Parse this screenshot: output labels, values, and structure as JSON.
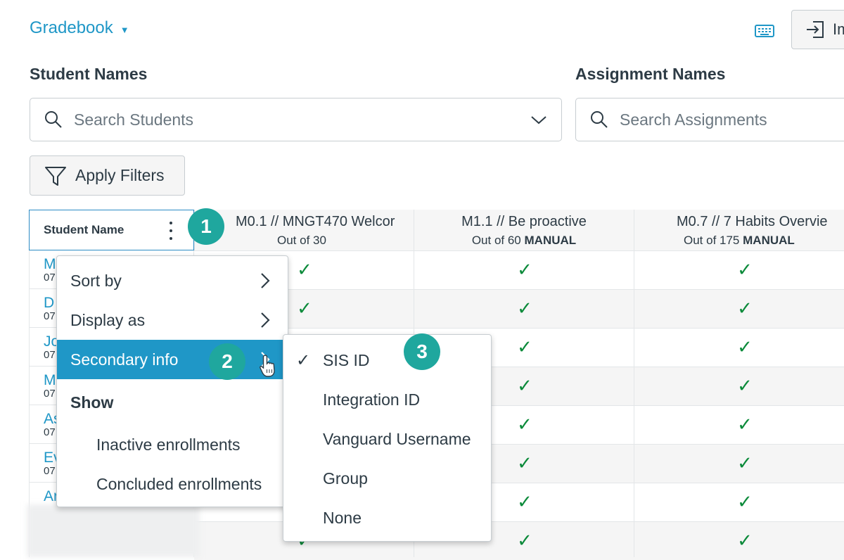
{
  "header": {
    "gradebook_label": "Gradebook",
    "import_label": "Im"
  },
  "filters": {
    "student_names_label": "Student Names",
    "student_search_placeholder": "Search Students",
    "assignment_names_label": "Assignment Names",
    "assignment_search_placeholder": "Search Assignments",
    "apply_filters_label": "Apply Filters"
  },
  "grid": {
    "student_column_header": "Student Name",
    "assignments": [
      {
        "title": "M0.1 // MNGT470 Welcor",
        "out_of": "Out of 30",
        "type_label": ""
      },
      {
        "title": "M1.1 // Be proactive",
        "out_of": "Out of 60",
        "type_label": "MANUAL"
      },
      {
        "title": "M0.7 // 7 Habits Overvie",
        "out_of": "Out of 175",
        "type_label": "MANUAL"
      }
    ],
    "students": [
      {
        "name": "M",
        "secondary": "07"
      },
      {
        "name": "D",
        "secondary": "07"
      },
      {
        "name": "Jo",
        "secondary": "07"
      },
      {
        "name": "M",
        "secondary": "07"
      },
      {
        "name": "As",
        "secondary": "07"
      },
      {
        "name": "Ev",
        "secondary": "07"
      },
      {
        "name": "Ar",
        "secondary": ""
      }
    ],
    "check_glyph": "✓"
  },
  "column_menu": {
    "items": [
      {
        "label": "Sort by"
      },
      {
        "label": "Display as"
      },
      {
        "label": "Secondary info"
      }
    ],
    "show_heading": "Show",
    "show_items": [
      {
        "label": "Inactive enrollments"
      },
      {
        "label": "Concluded enrollments"
      }
    ]
  },
  "secondary_info_menu": {
    "items": [
      {
        "label": "SIS ID",
        "selected": true
      },
      {
        "label": "Integration ID",
        "selected": false
      },
      {
        "label": "Vanguard Username",
        "selected": false
      },
      {
        "label": "Group",
        "selected": false
      },
      {
        "label": "None",
        "selected": false
      }
    ]
  },
  "callouts": [
    "1",
    "2",
    "3"
  ],
  "colors": {
    "accent": "#1f97c7",
    "badge": "#1fa79e",
    "check": "#0b8a3a",
    "text": "#2d3b45"
  }
}
